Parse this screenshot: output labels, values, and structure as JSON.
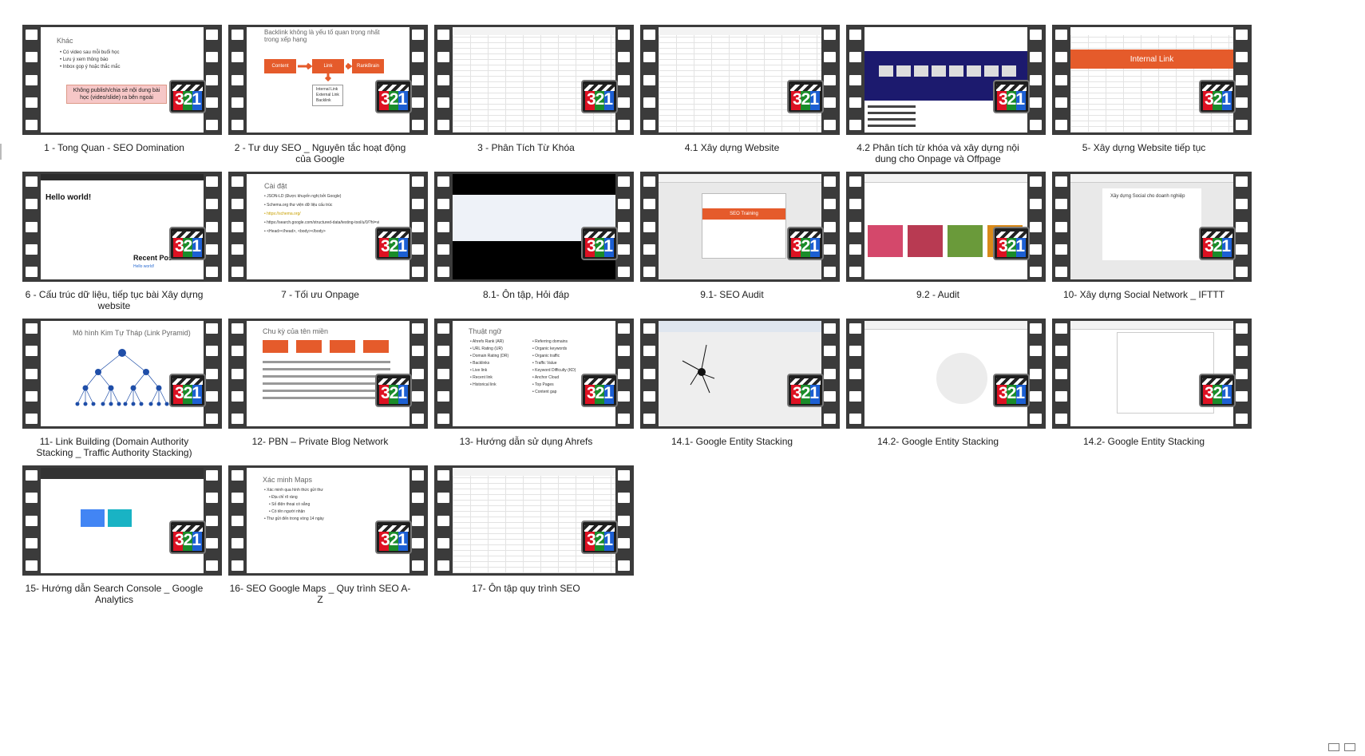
{
  "videos": [
    {
      "caption": "1 - Tong Quan - SEO Domination",
      "slide": {
        "title": "Khác",
        "bullets": [
          "Có video sau mỗi buổi học",
          "Lưu ý xem thông báo",
          "Inbox gop ý hoặc thắc mắc"
        ],
        "note": "Không publish/chia sẻ nội dung bài học (video/slide) ra bên ngoài"
      }
    },
    {
      "caption": "2 - Tư duy SEO _ Nguyên tắc hoạt động của Google",
      "slide": {
        "title": "Backlink không là yếu tố quan trọng nhất trong xếp hạng",
        "boxes": [
          "Content",
          "Link",
          "RankBrain"
        ],
        "list": [
          "Internal Link",
          "External Link",
          "Backlink"
        ]
      }
    },
    {
      "caption": "3 - Phân Tích Từ Khóa"
    },
    {
      "caption": "4.1 Xây dựng Website"
    },
    {
      "caption": "4.2 Phân tích từ khóa và xây dựng nội dung cho Onpage và Offpage"
    },
    {
      "caption": "5- Xây dựng Website tiếp tục",
      "slide": {
        "banner": "Internal Link"
      }
    },
    {
      "caption": "6 - Cấu trúc dữ liệu, tiếp tục bài Xây dựng website",
      "slide": {
        "heading": "Hello world!",
        "side": "Recent Posts",
        "link": "Hello world!"
      }
    },
    {
      "caption": "7 - Tối ưu Onpage",
      "slide": {
        "title": "Cài đặt",
        "bullets": [
          "JSON-LD (Được khuyến nghị bởi Google)",
          "Schema.org thư viện dữ liệu cấu trúc",
          "https://schema.org/",
          "https://search.google.com/structured-data/testing-tool/u/0/?hl=vi",
          "<Head></head>, <body></body>"
        ]
      }
    },
    {
      "caption": "8.1- Ôn tập, Hỏi đáp"
    },
    {
      "caption": "9.1- SEO Audit",
      "slide": {
        "banner": "SEO Training"
      }
    },
    {
      "caption": "9.2 - Audit"
    },
    {
      "caption": "10- Xây dựng Social Network _ IFTTT",
      "slide": {
        "title": "Xây dựng Social cho doanh nghiệp"
      }
    },
    {
      "caption": "11- Link Building (Domain Authority Stacking _ Traffic Authority Stacking)",
      "slide": {
        "title": "Mô hình Kim Tự Tháp (Link Pyramid)"
      }
    },
    {
      "caption": "12- PBN – Private Blog Network",
      "slide": {
        "title": "Chu kỳ của tên miền"
      }
    },
    {
      "caption": "13- Hướng dẫn sử dụng Ahrefs",
      "slide": {
        "title": "Thuật ngữ",
        "col1": [
          "Ahrefs Rank (AR)",
          "URL Rating (UR)",
          "Domain Rating (DR)",
          "Backlinks",
          "Live link",
          "Recent link",
          "Historical link"
        ],
        "col2": [
          "Referring domains",
          "Organic keywords",
          "Organic traffic",
          "Traffic Value",
          "Keyword Difficulty (KD)",
          "Anchor Cloud",
          "Top Pages",
          "Content gap"
        ]
      }
    },
    {
      "caption": "14.1- Google Entity Stacking"
    },
    {
      "caption": "14.2- Google Entity Stacking"
    },
    {
      "caption": "14.2- Google Entity Stacking"
    },
    {
      "caption": "15- Hướng dẫn Search Console _ Google Analytics"
    },
    {
      "caption": "16- SEO Google Maps _ Quy trình SEO A-Z",
      "slide": {
        "title": "Xác minh Maps",
        "bullets": [
          "Xác minh qua hình thức gửi thư",
          "Địa chỉ rõ ràng",
          "Số điện thoại có sẵng",
          "Có tên người nhận",
          "Thư gửi đến trong vòng 14 ngày"
        ]
      }
    },
    {
      "caption": "17- Ôn tập quy trình SEO"
    }
  ],
  "badge_label": "321",
  "colors": {
    "accent_red": "#e55b2b",
    "navy": "#1c1a6e",
    "search_blue": "#4285f4",
    "teal": "#19b3c4"
  }
}
